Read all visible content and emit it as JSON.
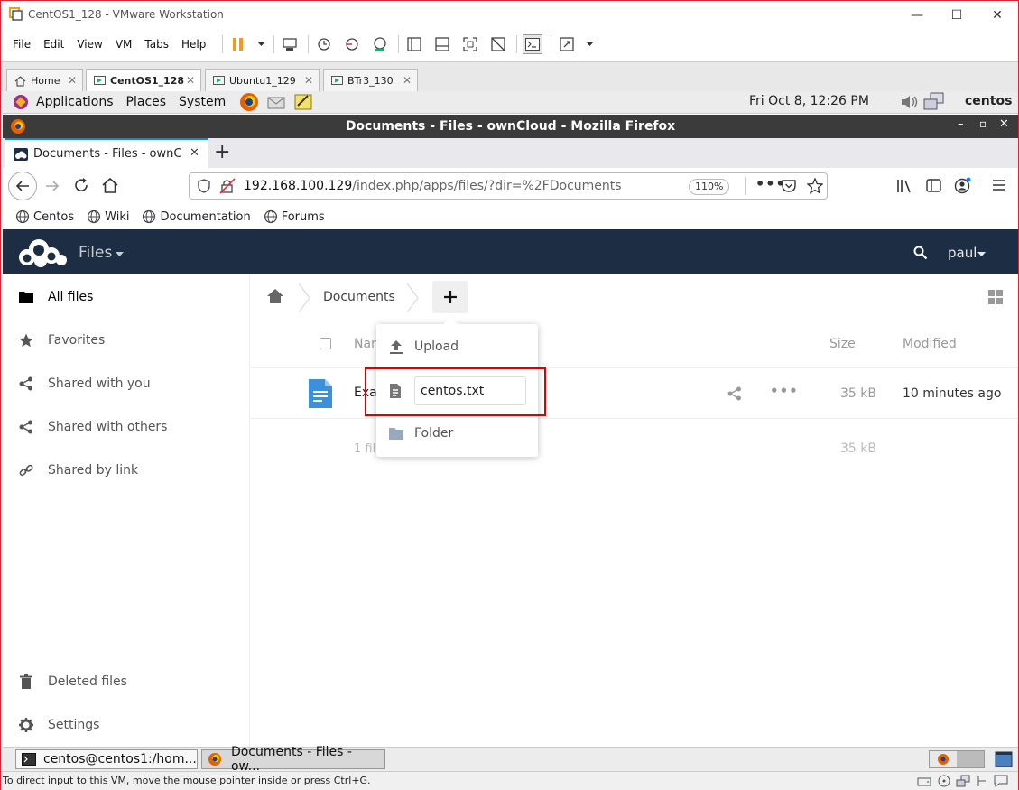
{
  "vmware": {
    "window_title": "CentOS1_128 - VMware Workstation",
    "menu": [
      "File",
      "Edit",
      "View",
      "VM",
      "Tabs",
      "Help"
    ],
    "tabs": [
      {
        "label": "Home"
      },
      {
        "label": "CentOS1_128"
      },
      {
        "label": "Ubuntu1_129"
      },
      {
        "label": "BTr3_130"
      }
    ],
    "status_text": "To direct input to this VM, move the mouse pointer inside or press Ctrl+G."
  },
  "gnome": {
    "menus": [
      "Applications",
      "Places",
      "System"
    ],
    "clock": "Fri Oct  8, 12:26 PM",
    "user": "centos",
    "taskbar": [
      {
        "label": "centos@centos1:/hom..."
      },
      {
        "label": "Documents - Files - ow..."
      }
    ]
  },
  "firefox": {
    "window_title": "Documents - Files - ownCloud - Mozilla Firefox",
    "tab_title": "Documents - Files - ownC",
    "url_host": "192.168.100.129",
    "url_path": "/index.php/apps/files/?dir=%2FDocuments",
    "zoom": "110%",
    "bookmarks": [
      "Centos",
      "Wiki",
      "Documentation",
      "Forums"
    ]
  },
  "owncloud": {
    "app_name": "Files",
    "user": "paul",
    "sidebar": {
      "items": [
        "All files",
        "Favorites",
        "Shared with you",
        "Shared with others",
        "Shared by link"
      ],
      "deleted": "Deleted files",
      "settings": "Settings"
    },
    "breadcrumb": "Documents",
    "columns": {
      "name": "Name",
      "size": "Size",
      "modified": "Modified"
    },
    "file": {
      "name": "Exa",
      "size": "35 kB",
      "modified": "10 minutes ago"
    },
    "summary": {
      "count": "1 fil",
      "size": "35 kB"
    },
    "new_menu": {
      "upload": "Upload",
      "filename_value": "centos.txt",
      "folder": "Folder"
    },
    "colors": {
      "header": "#1d2d44",
      "highlight": "#dd0000",
      "doc_icon": "#3c8fd9"
    }
  }
}
